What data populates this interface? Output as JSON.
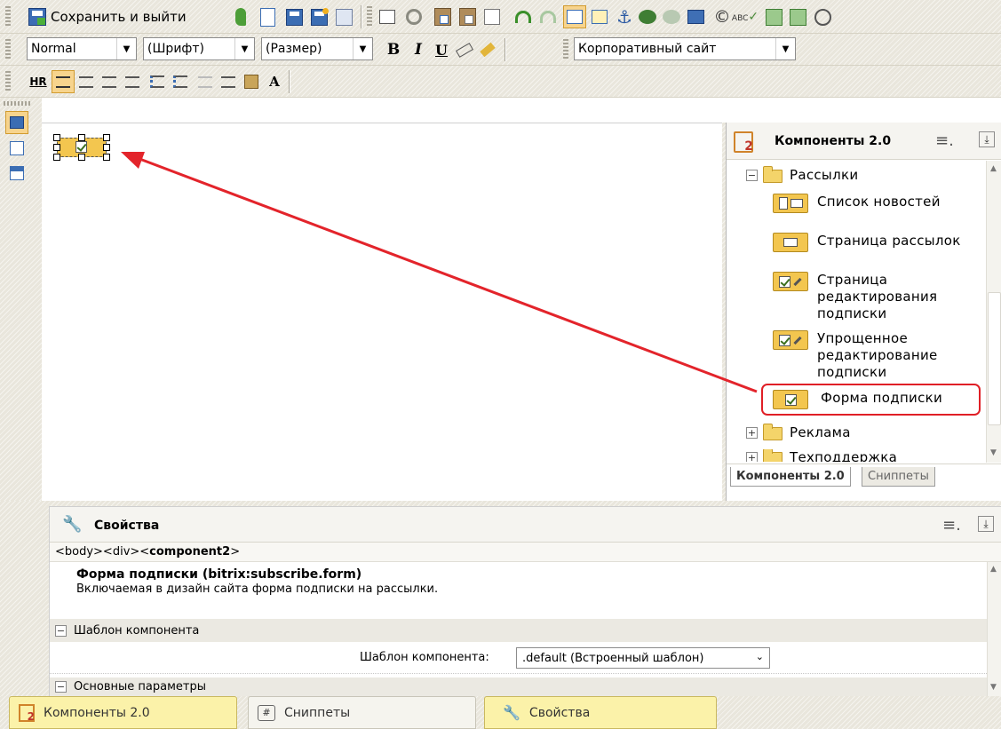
{
  "toolbar1": {
    "save_exit_label": "Сохранить и выйти"
  },
  "toolbar2": {
    "style_value": "Normal",
    "font_value": "(Шрифт)",
    "size_value": "(Размер)",
    "bold_label": "B",
    "italic_label": "I",
    "underline_label": "U",
    "template_value": "Корпоративный сайт"
  },
  "toolbar3": {
    "hr_label": "HR",
    "ha_label": "A"
  },
  "components_panel": {
    "title": "Компоненты 2.0",
    "folder_open": "Рассылки",
    "items": [
      {
        "label": "Список новостей"
      },
      {
        "label": "Страница рассылок"
      },
      {
        "label": "Страница редактирования подписки"
      },
      {
        "label": "Упрощенное редактирование подписки"
      },
      {
        "label": "Форма подписки"
      }
    ],
    "folder_ads": "Реклама",
    "folder_support": "Техподдержка",
    "tab_active": "Компоненты 2.0",
    "tab_inactive": "Сниппеты"
  },
  "properties_panel": {
    "title": "Свойства",
    "path_prefix": "<body><div><",
    "path_bold": "component2",
    "path_suffix": ">",
    "component_name": "Форма подписки (bitrix:subscribe.form)",
    "component_desc": "Включаемая в дизайн сайта форма подписки на рассылки.",
    "section_template": "Шаблон компонента",
    "template_label": "Шаблон компонента:",
    "template_value": ".default (Встроенный шаблон)",
    "section_main": "Основные параметры"
  },
  "bottom_tabs": [
    {
      "label": "Компоненты 2.0"
    },
    {
      "label": "Сниппеты"
    },
    {
      "label": "Свойства"
    }
  ],
  "colors": {
    "highlight": "#e01f26",
    "arrow": "#e3242b",
    "toolbar_bg": "#e9e6dc",
    "tab_bg": "#fbf2a9"
  }
}
